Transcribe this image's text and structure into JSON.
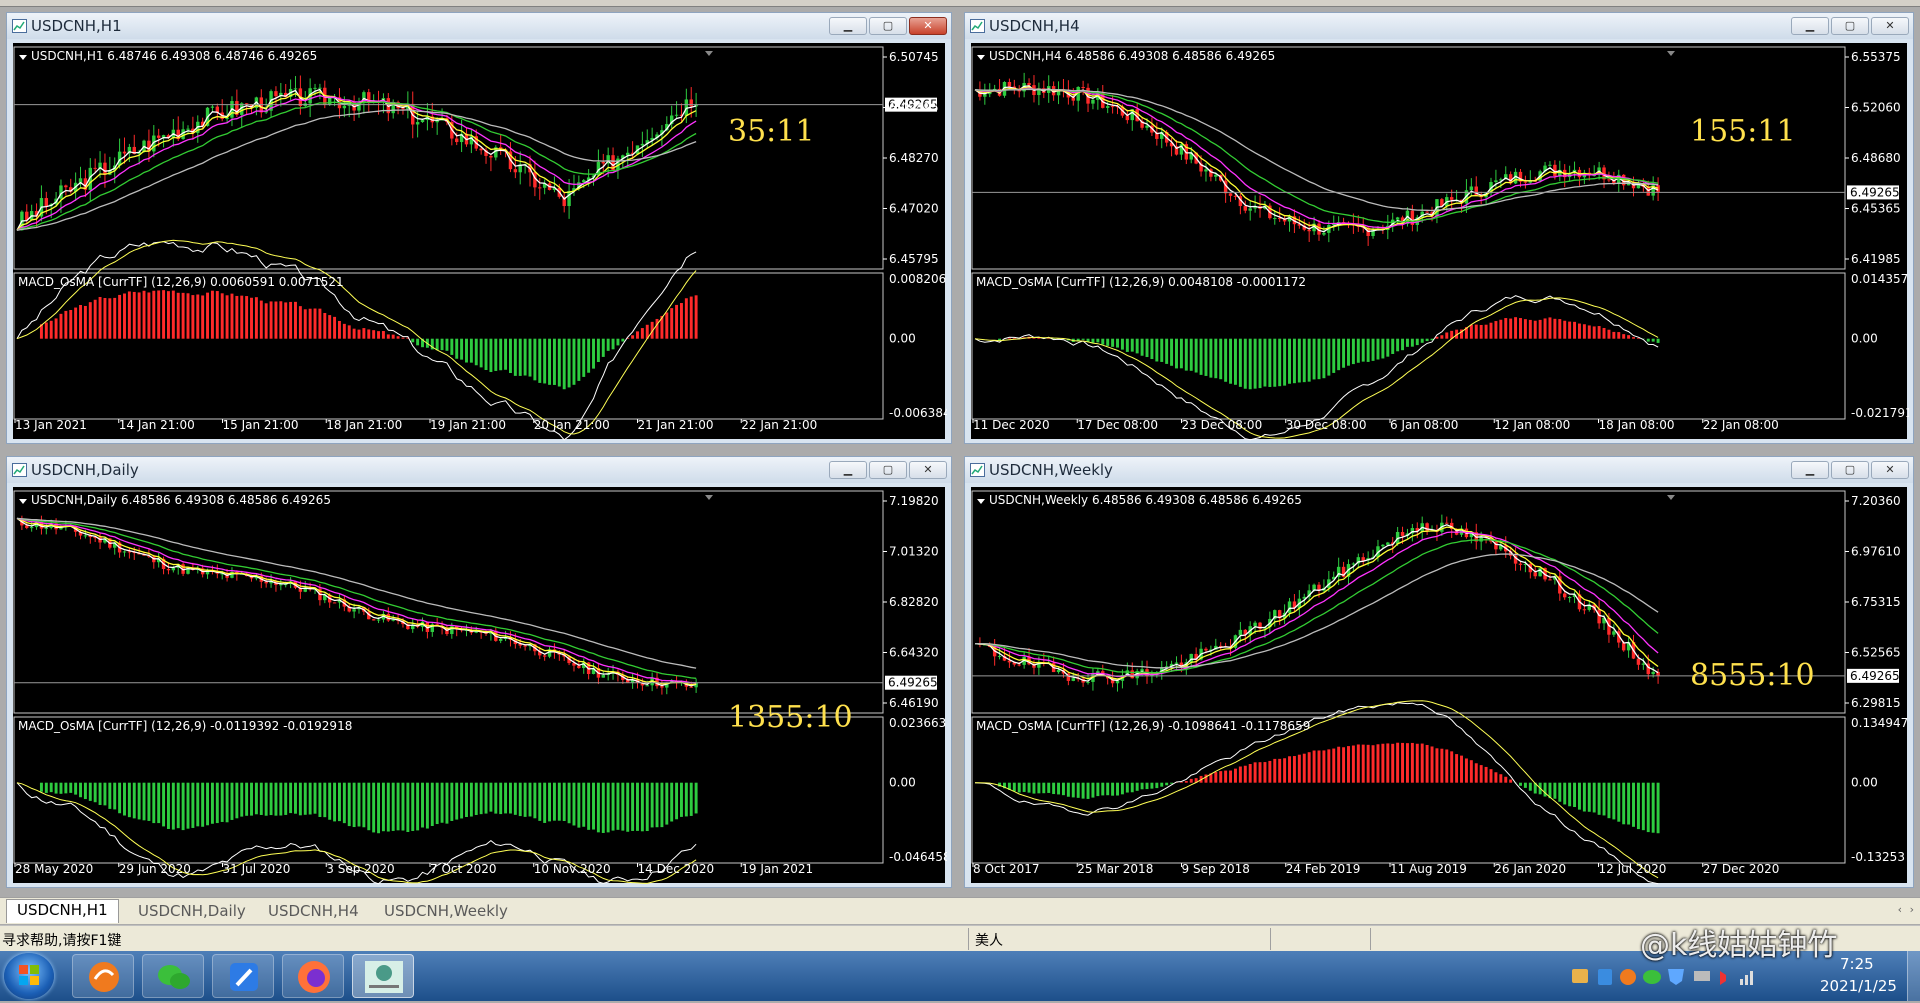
{
  "colors": {
    "bull": "#2ecc40",
    "bear": "#ff2a2a",
    "ma1": "#ffffff",
    "ma2": "#ffff33",
    "ma3": "#ff33ff",
    "ma4": "#33cc33",
    "ma5": "#bbbbbb",
    "timer": "#ffe14d"
  },
  "windows": [
    {
      "id": "h1",
      "title": "USDCNH,H1",
      "info": "USDCNH,H1  6.48746 6.49308 6.48746 6.49265",
      "macd": "MACD_OsMA [CurrTF] (12,26,9) 0.0060591 0.0071521",
      "timer": "35:11",
      "price_ticks": [
        "6.50745",
        "6.49495",
        "6.48270",
        "6.47020",
        "6.45795"
      ],
      "current_price": "6.49265",
      "macd_ticks": [
        "0.0082069",
        "0.00",
        "-0.0063843"
      ],
      "time_labels": [
        "13 Jan 2021",
        "14 Jan 21:00",
        "15 Jan 21:00",
        "18 Jan 21:00",
        "19 Jan 21:00",
        "20 Jan 21:00",
        "21 Jan 21:00",
        "22 Jan 21:00"
      ],
      "seed": 3
    },
    {
      "id": "h4",
      "title": "USDCNH,H4",
      "info": "USDCNH,H4  6.48586 6.49308 6.48586 6.49265",
      "macd": "MACD_OsMA [CurrTF] (12,26,9) 0.0048108 -0.0001172",
      "timer": "155:11",
      "price_ticks": [
        "6.55375",
        "6.52060",
        "6.48680",
        "6.45365",
        "6.41985"
      ],
      "current_price": "6.49265",
      "macd_ticks": [
        "0.0143575",
        "0.00",
        "-0.0217912"
      ],
      "time_labels": [
        "11 Dec 2020",
        "17 Dec 08:00",
        "23 Dec 08:00",
        "30 Dec 08:00",
        "6 Jan 08:00",
        "12 Jan 08:00",
        "18 Jan 08:00",
        "22 Jan 08:00"
      ],
      "seed": 7
    },
    {
      "id": "d1",
      "title": "USDCNH,Daily",
      "info": "USDCNH,Daily  6.48586 6.49308 6.48586 6.49265",
      "macd": "MACD_OsMA [CurrTF] (12,26,9) -0.0119392 -0.0192918",
      "timer": "1355:10",
      "price_ticks": [
        "7.19820",
        "7.01320",
        "6.82820",
        "6.64320",
        "6.46190"
      ],
      "current_price": "6.49265",
      "macd_ticks": [
        "0.0236636",
        "0.00",
        "-0.0464584"
      ],
      "time_labels": [
        "28 May 2020",
        "29 Jun 2020",
        "31 Jul 2020",
        "3 Sep 2020",
        "7 Oct 2020",
        "10 Nov 2020",
        "14 Dec 2020",
        "19 Jan 2021"
      ],
      "seed": 11
    },
    {
      "id": "w1",
      "title": "USDCNH,Weekly",
      "info": "USDCNH,Weekly  6.48586 6.49308 6.48586 6.49265",
      "macd": "MACD_OsMA [CurrTF] (12,26,9) -0.1098641 -0.1178659",
      "timer": "8555:10",
      "price_ticks": [
        "7.20360",
        "6.97610",
        "6.75315",
        "6.52565",
        "6.29815"
      ],
      "current_price": "6.49265",
      "macd_ticks": [
        "0.134947",
        "0.00",
        "-0.13253"
      ],
      "time_labels": [
        "8 Oct 2017",
        "25 Mar 2018",
        "9 Sep 2018",
        "24 Feb 2019",
        "11 Aug 2019",
        "26 Jan 2020",
        "12 Jul 2020",
        "27 Dec 2020"
      ],
      "seed": 19
    }
  ],
  "tabs": [
    "USDCNH,H1",
    "USDCNH,Daily",
    "USDCNH,H4",
    "USDCNH,Weekly"
  ],
  "status": {
    "help": "寻求帮助,请按F1键",
    "profile": "美人"
  },
  "clock": {
    "time": "7:25",
    "date": "2021/1/25"
  },
  "watermark": "@k线姑姑钟竹"
}
